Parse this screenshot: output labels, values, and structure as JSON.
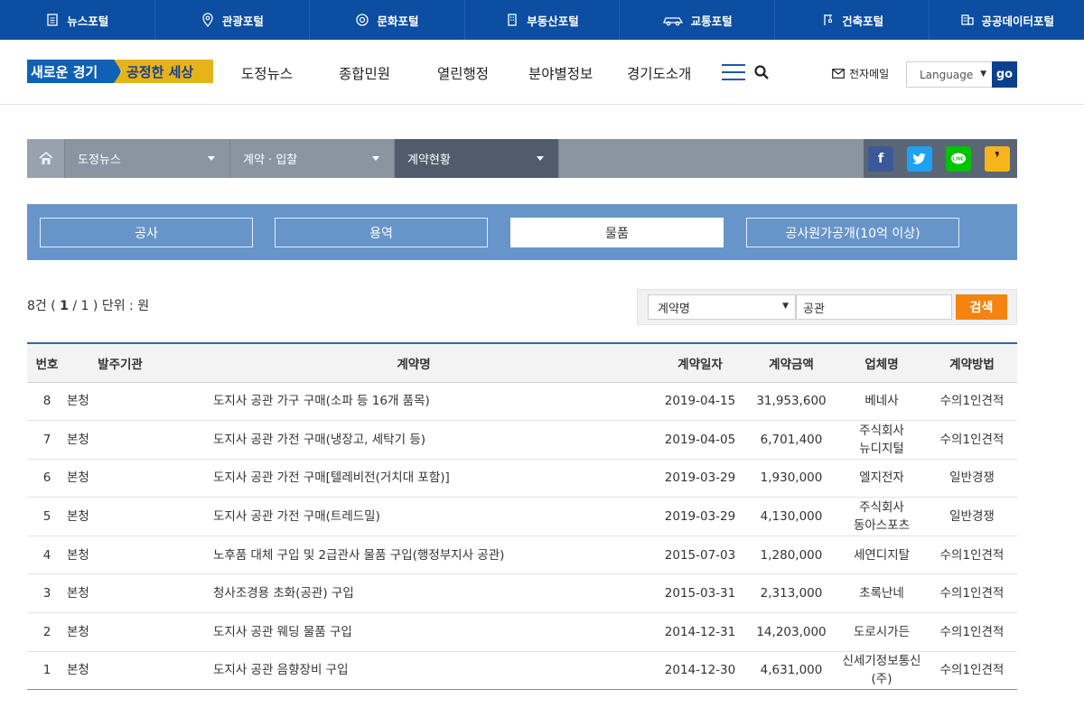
{
  "portal": [
    {
      "label": "뉴스포털",
      "icon": "document-icon"
    },
    {
      "label": "관광포털",
      "icon": "map-pin-icon"
    },
    {
      "label": "문화포털",
      "icon": "culture-icon"
    },
    {
      "label": "부동산포털",
      "icon": "building-icon"
    },
    {
      "label": "교통포털",
      "icon": "car-icon"
    },
    {
      "label": "건축포털",
      "icon": "crane-icon"
    },
    {
      "label": "공공데이터포털",
      "icon": "data-icon"
    }
  ],
  "header": {
    "logo_left": "새로운 경기",
    "logo_right": "공정한 세상",
    "nav": [
      "도정뉴스",
      "종합민원",
      "열린행정",
      "분야별정보",
      "경기도소개"
    ],
    "email_label": "전자메일",
    "language": "Language",
    "go": "go"
  },
  "breadcrumb": {
    "items": [
      "도정뉴스",
      "계약 · 입찰",
      "계약현황"
    ]
  },
  "sns": [
    "f",
    "t",
    "line",
    "talk"
  ],
  "tabs": [
    "공사",
    "용역",
    "물품",
    "공사원가공개(10억 이상)"
  ],
  "listing": {
    "count_prefix": "8건 ( ",
    "page": "1",
    "sep": " / ",
    "total_pages": "1",
    "count_suffix": " ) 단위 : 원"
  },
  "search": {
    "field": "계약명",
    "keyword": "공관",
    "button": "검색"
  },
  "table": {
    "headers": [
      "번호",
      "발주기관",
      "계약명",
      "계약일자",
      "계약금액",
      "업체명",
      "계약방법"
    ],
    "rows": [
      [
        "8",
        "본청",
        "도지사 공관 가구 구매(소파 등 16개 품목)",
        "2019-04-15",
        "31,953,600",
        "베네사",
        "수의1인견적"
      ],
      [
        "7",
        "본청",
        "도지사 공관 가전 구매(냉장고, 세탁기 등)",
        "2019-04-05",
        "6,701,400",
        "주식회사 뉴디지털",
        "수의1인견적"
      ],
      [
        "6",
        "본청",
        "도지사 공관 가전 구매[텔레비전(거치대 포함)]",
        "2019-03-29",
        "1,930,000",
        "엘지전자",
        "일반경쟁"
      ],
      [
        "5",
        "본청",
        "도지사 공관 가전 구매(트레드밀)",
        "2019-03-29",
        "4,130,000",
        "주식회사 동아스포츠",
        "일반경쟁"
      ],
      [
        "4",
        "본청",
        "노후품 대체 구입 및 2급관사 물품 구입(행정부지사 공관)",
        "2015-07-03",
        "1,280,000",
        "세연디지탈",
        "수의1인견적"
      ],
      [
        "3",
        "본청",
        "청사조경용 초화(공관) 구입",
        "2015-03-31",
        "2,313,000",
        "초록난네",
        "수의1인견적"
      ],
      [
        "2",
        "본청",
        "도지사 공관 웨딩 물품 구입",
        "2014-12-31",
        "14,203,000",
        "도로시가든",
        "수의1인견적"
      ],
      [
        "1",
        "본청",
        "도지사 공관 음향장비 구입",
        "2014-12-30",
        "4,631,000",
        "신세기정보통신(주)",
        "수의1인견적"
      ]
    ]
  }
}
